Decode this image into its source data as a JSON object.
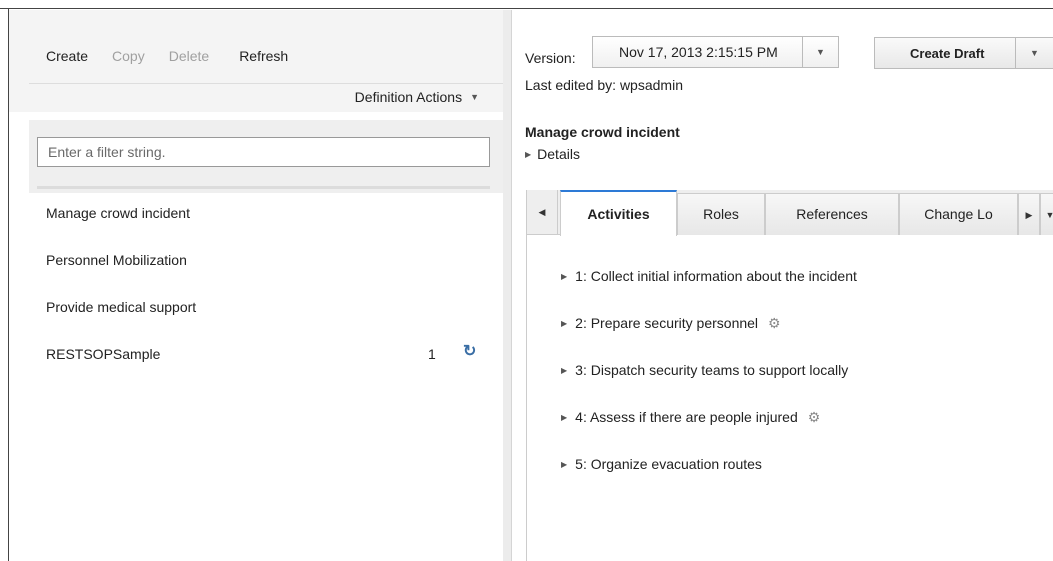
{
  "toolbar": {
    "create_label": "Create",
    "copy_label": "Copy",
    "delete_label": "Delete",
    "refresh_label": "Refresh",
    "definition_actions_label": "Definition Actions"
  },
  "filter": {
    "placeholder": "Enter a filter string."
  },
  "definitions": [
    {
      "name": "Manage crowd incident",
      "count": "",
      "has_refresh": false
    },
    {
      "name": "Personnel Mobilization",
      "count": "",
      "has_refresh": false
    },
    {
      "name": "Provide medical support",
      "count": "",
      "has_refresh": false
    },
    {
      "name": "RESTSOPSample",
      "count": "1",
      "has_refresh": true
    }
  ],
  "detail": {
    "version_label": "Version:",
    "version_value": "Nov 17, 2013 2:15:15 PM",
    "create_draft_label": "Create Draft",
    "last_edited": "Last edited by: wpsadmin",
    "title": "Manage crowd incident",
    "details_label": "Details"
  },
  "tabs": [
    {
      "label": "Activities",
      "active": true
    },
    {
      "label": "Roles",
      "active": false
    },
    {
      "label": "References",
      "active": false
    },
    {
      "label": "Change Lo",
      "active": false
    }
  ],
  "activities": [
    {
      "label": "1: Collect initial information about the incident",
      "automated": false
    },
    {
      "label": "2: Prepare security personnel",
      "automated": true
    },
    {
      "label": "3: Dispatch security teams to support locally",
      "automated": false
    },
    {
      "label": "4: Assess if there are people injured",
      "automated": true
    },
    {
      "label": "5: Organize evacuation routes",
      "automated": false
    }
  ],
  "icons": {
    "refresh": "refresh-icon",
    "gear": "gear-icon",
    "caret_down": "chevron-down-icon",
    "triangle_right": "triangle-right-icon",
    "triangle_left": "triangle-left-icon"
  },
  "colors": {
    "active_tab_accent": "#2d7ad6",
    "refresh_icon": "#3a6ea5"
  }
}
